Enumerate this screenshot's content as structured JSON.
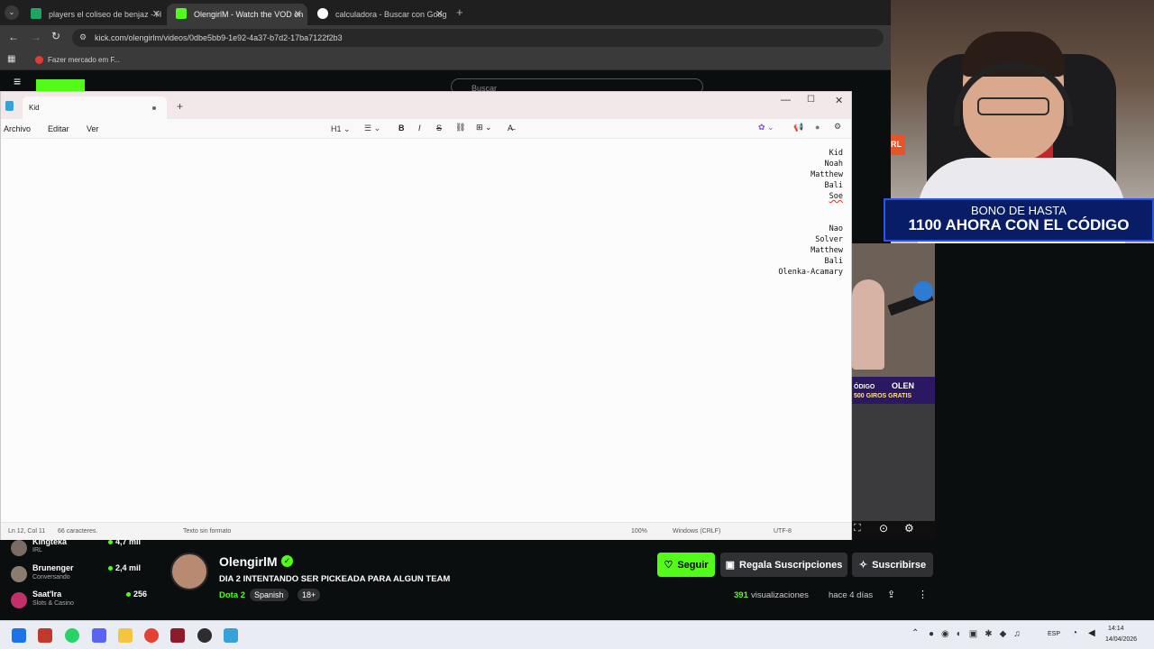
{
  "browser": {
    "tabs": [
      {
        "label": "players el coliseo de benjaz - H",
        "color": "#1fa463"
      },
      {
        "label": "OlengirlM - Watch the VOD on",
        "color": "#53fc18"
      },
      {
        "label": "calculadora - Buscar con Goog",
        "color": "#ffffff"
      }
    ],
    "url": "kick.com/olengirlm/videos/0dbe5bb9-1e92-4a37-b7d2-17ba7122f2b3",
    "bookmark": "Fazer mercado em F...",
    "search_placeholder": "Buscar"
  },
  "notepad": {
    "tab_title": "Kid",
    "menu": [
      "Archivo",
      "Editar",
      "Ver"
    ],
    "heading_select": "H1",
    "lines": [
      "Kid",
      "Noah",
      "Matthew",
      "Bali",
      "Soe",
      "",
      "",
      "Nao",
      "Solver",
      "Matthew",
      "Bali",
      "Olenka-Acamary"
    ],
    "status": {
      "position": "Ln 12, Col 11",
      "chars": "66 caracteres.",
      "format": "Texto sin formato",
      "zoom": "100%",
      "eol": "Windows (CRLF)",
      "encoding": "UTF-8"
    }
  },
  "promo": {
    "line1": "BONO DE HASTA",
    "line2": "1100 AHORA CON EL CÓDIGO"
  },
  "overlay": {
    "code_label": "ÓDIGO",
    "code": "OLEN",
    "giros": "500 GIROS GRATIS"
  },
  "sidebar_users": [
    {
      "name": "Kingteka",
      "sub": "IRL",
      "count": "4,7 mil"
    },
    {
      "name": "Brunenger",
      "sub": "Conversando",
      "count": "2,4 mil"
    },
    {
      "name": "Saat'Ira",
      "sub": "Slots & Casino",
      "count": "256"
    }
  ],
  "channel": {
    "name": "OlengirlM",
    "title": "DIA 2 INTENTANDO SER PICKEADA PARA ALGUN TEAM",
    "category": "Dota 2",
    "tags": [
      "Spanish",
      "18+"
    ],
    "follow": "Seguir",
    "gift": "Regala Suscripciones",
    "subscribe": "Suscribirse",
    "views_count": "391",
    "views_label": "visualizaciones",
    "age": "hace 4 días"
  },
  "taskbar": {
    "lang": "ESP",
    "time": "14:14",
    "date": "14/04/2026"
  },
  "colors": {
    "kick_green": "#53fc18",
    "promo_blue": "#081d66"
  }
}
